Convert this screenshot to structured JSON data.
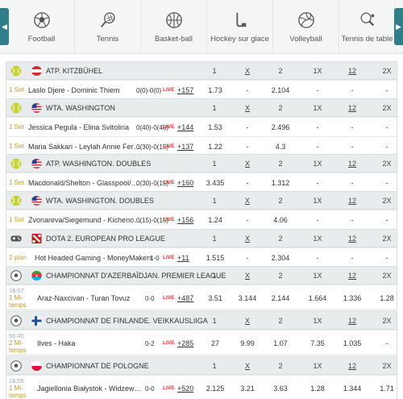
{
  "nav": {
    "left_arrow": "◀",
    "right_arrow": "▶",
    "sports": [
      {
        "label": "Football",
        "icon": "soccer-ball-icon"
      },
      {
        "label": "Tennis",
        "icon": "tennis-racket-icon"
      },
      {
        "label": "Basket-ball",
        "icon": "basketball-icon"
      },
      {
        "label": "Hockey sur glace",
        "icon": "hockey-stick-icon"
      },
      {
        "label": "Volleyball",
        "icon": "volleyball-icon"
      },
      {
        "label": "Tennis de table",
        "icon": "table-tennis-icon"
      }
    ]
  },
  "columns": [
    "1",
    "X",
    "2",
    "1X",
    "12",
    "2X"
  ],
  "live_label": "LIVE",
  "colors": {
    "accent": "#2e7f8a",
    "status": "#c99a2e",
    "live": "#e03131",
    "header_bg": "#e8ecec"
  },
  "leagues": [
    {
      "name": "ATP. KITZBÜHEL",
      "sport_icon": "tennis-ball-icon",
      "flag": "austria-flag",
      "matches": [
        {
          "status": "1 Set",
          "time": "",
          "teams": "Laslo Djere - Dominic Thiem",
          "score": "0(0)-0(0)",
          "more": "+157",
          "odds": [
            "1.73",
            "-",
            "2.104",
            "-",
            "-",
            "-"
          ]
        }
      ]
    },
    {
      "name": "WTA. WASHINGTON",
      "sport_icon": "tennis-ball-icon",
      "flag": "usa-flag",
      "matches": [
        {
          "status": "1 Set",
          "time": "",
          "teams": "Jessica Pegula - Elina Svitolina",
          "score": "0(40)-0(40)",
          "more": "+144",
          "odds": [
            "1.53",
            "-",
            "2.496",
            "-",
            "-",
            "-"
          ]
        },
        {
          "status": "1 Set",
          "time": "",
          "teams": "Maria Sakkari - Leylah Annie Fernandez",
          "score": "0(30)-0(15)",
          "more": "+137",
          "odds": [
            "1.22",
            "-",
            "4.3",
            "-",
            "-",
            "-"
          ]
        }
      ]
    },
    {
      "name": "ATP. WASHINGTON. DOUBLES",
      "sport_icon": "tennis-ball-icon",
      "flag": "usa-flag",
      "matches": [
        {
          "status": "1 Set",
          "time": "",
          "teams": "Macdonald/Shelton - Glasspool/Heliovaara",
          "score": "0(30)-0(15)",
          "more": "+160",
          "odds": [
            "3.435",
            "-",
            "1.312",
            "-",
            "-",
            "-"
          ]
        }
      ]
    },
    {
      "name": "WTA. WASHINGTON. DOUBLES",
      "sport_icon": "tennis-ball-icon",
      "flag": "usa-flag",
      "matches": [
        {
          "status": "1 Set",
          "time": "",
          "teams": "Zvonareva/Siegemund - Kichenok/Ostapenko",
          "score": "0(15)-0(15)",
          "more": "+156",
          "odds": [
            "1.24",
            "-",
            "4.06",
            "-",
            "-",
            "-"
          ]
        }
      ]
    },
    {
      "name": "DOTA 2. EUROPEAN PRO LEAGUE",
      "sport_icon": "gamepad-icon",
      "flag": "dota-logo",
      "matches": [
        {
          "status": "2 plan",
          "time": "",
          "teams": "Hot Headed Gaming - MoneyMakers",
          "score": "1-0",
          "more": "+11",
          "odds": [
            "1.515",
            "-",
            "2.304",
            "-",
            "-",
            "-"
          ]
        }
      ]
    },
    {
      "name": "CHAMPIONNAT D'AZERBAÏDJAN. PREMIER LEAGUE",
      "sport_icon": "soccer-ball-icon",
      "flag": "azerbaijan-flag",
      "matches": [
        {
          "status": "1 Mi-temps",
          "time": "16:07",
          "teams": "Araz-Naxcivan - Turan Tovuz",
          "score": "0-0",
          "more": "+487",
          "odds": [
            "3.51",
            "3.144",
            "2.144",
            "1.664",
            "1.336",
            "1.28"
          ]
        }
      ]
    },
    {
      "name": "CHAMPIONNAT DE FINLANDE. VEIKKAUSLIIGA",
      "sport_icon": "soccer-ball-icon",
      "flag": "finland-flag",
      "matches": [
        {
          "status": "2 Mi-temps",
          "time": "56:45",
          "teams": "Ilves - Haka",
          "score": "0-2",
          "more": "+285",
          "odds": [
            "27",
            "9.99",
            "1.07",
            "7.35",
            "1.035",
            "-"
          ]
        }
      ]
    },
    {
      "name": "CHAMPIONNAT DE POLOGNE",
      "sport_icon": "soccer-ball-icon",
      "flag": "poland-flag",
      "matches": [
        {
          "status": "1 Mi-temps",
          "time": "16:05",
          "teams": "Jagiellonia Białystok - Widzew Łódź",
          "score": "0-0",
          "more": "+520",
          "odds": [
            "2.125",
            "3.21",
            "3.63",
            "1.28",
            "1.344",
            "1.71"
          ]
        }
      ]
    }
  ]
}
